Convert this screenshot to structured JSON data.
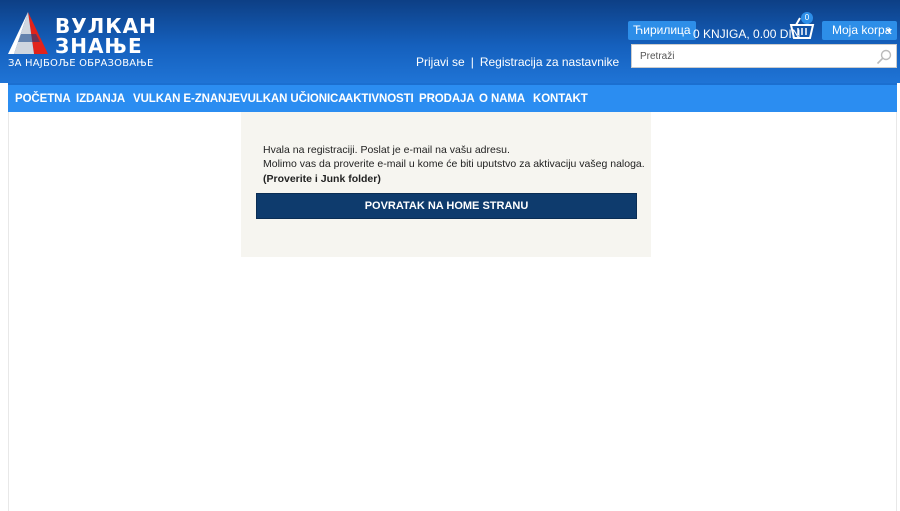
{
  "brand": {
    "line1": "ВУЛКАН",
    "line2": "ЗНАЊЕ",
    "tagline": "ЗА НАЈБОЉЕ ОБРАЗОВАЊЕ",
    "colors": {
      "header": "#1560bd",
      "nav": "#2b8df1",
      "button": "#0e3b6d",
      "panel": "#f6f5f0",
      "logo_red": "#e2231a"
    }
  },
  "auth": {
    "login": "Prijavi se",
    "separator": "|",
    "register_teachers": "Registracija za nastavnike"
  },
  "header": {
    "language_button": "Ћирилица",
    "cart_summary": "0 KNJIGA, 0.00 DIN",
    "basket_count": "0",
    "basket_icon": "basket-icon",
    "cart_button": "Moja korpa",
    "search_placeholder": "Pretraži",
    "search_icon": "search-icon"
  },
  "nav": {
    "items": [
      "POČETNA",
      "IZDANJA",
      "VULKAN E-ZNANJE",
      "VULKAN UČIONICA",
      "AKTIVNOSTI",
      "PRODAJA",
      "O NAMA",
      "KONTAKT"
    ]
  },
  "message": {
    "line1": "Hvala na registraciji. Poslat je e-mail na vašu adresu.",
    "line2": "Molimo vas da proverite e-mail u kome će biti uputstvo za aktivaciju vašeg naloga.",
    "line3": "(Proverite i Junk folder)",
    "button": "POVRATAK NA HOME STRANU"
  }
}
